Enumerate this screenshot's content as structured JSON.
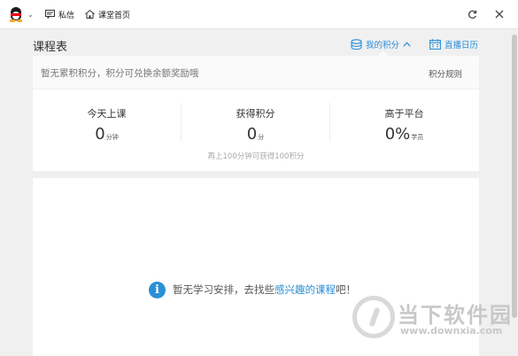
{
  "topbar": {
    "avatar_icon": "qq-penguin-icon",
    "messages_label": "私信",
    "home_label": "课堂首页"
  },
  "header": {
    "title": "课程表",
    "my_points_label": "我的积分",
    "calendar_label": "直播日历"
  },
  "points": {
    "note": "暂无累积积分，积分可兑换余额奖励哦",
    "rules_label": "积分规则",
    "stats": [
      {
        "label": "今天上课",
        "value": "0",
        "unit": "分钟"
      },
      {
        "label": "获得积分",
        "value": "0",
        "unit": "分"
      },
      {
        "label": "高于平台",
        "value": "0%",
        "unit": "学员"
      }
    ],
    "tip": "再上100分钟可获得100积分"
  },
  "main": {
    "empty_prefix": "暂无学习安排，去找些",
    "empty_link": "感兴趣的课程",
    "empty_suffix": "吧！"
  },
  "watermark": {
    "name": "当下软件园",
    "url": "www.downxia.com"
  },
  "colors": {
    "accent": "#2b8fd6",
    "background": "#f0f0f0"
  }
}
